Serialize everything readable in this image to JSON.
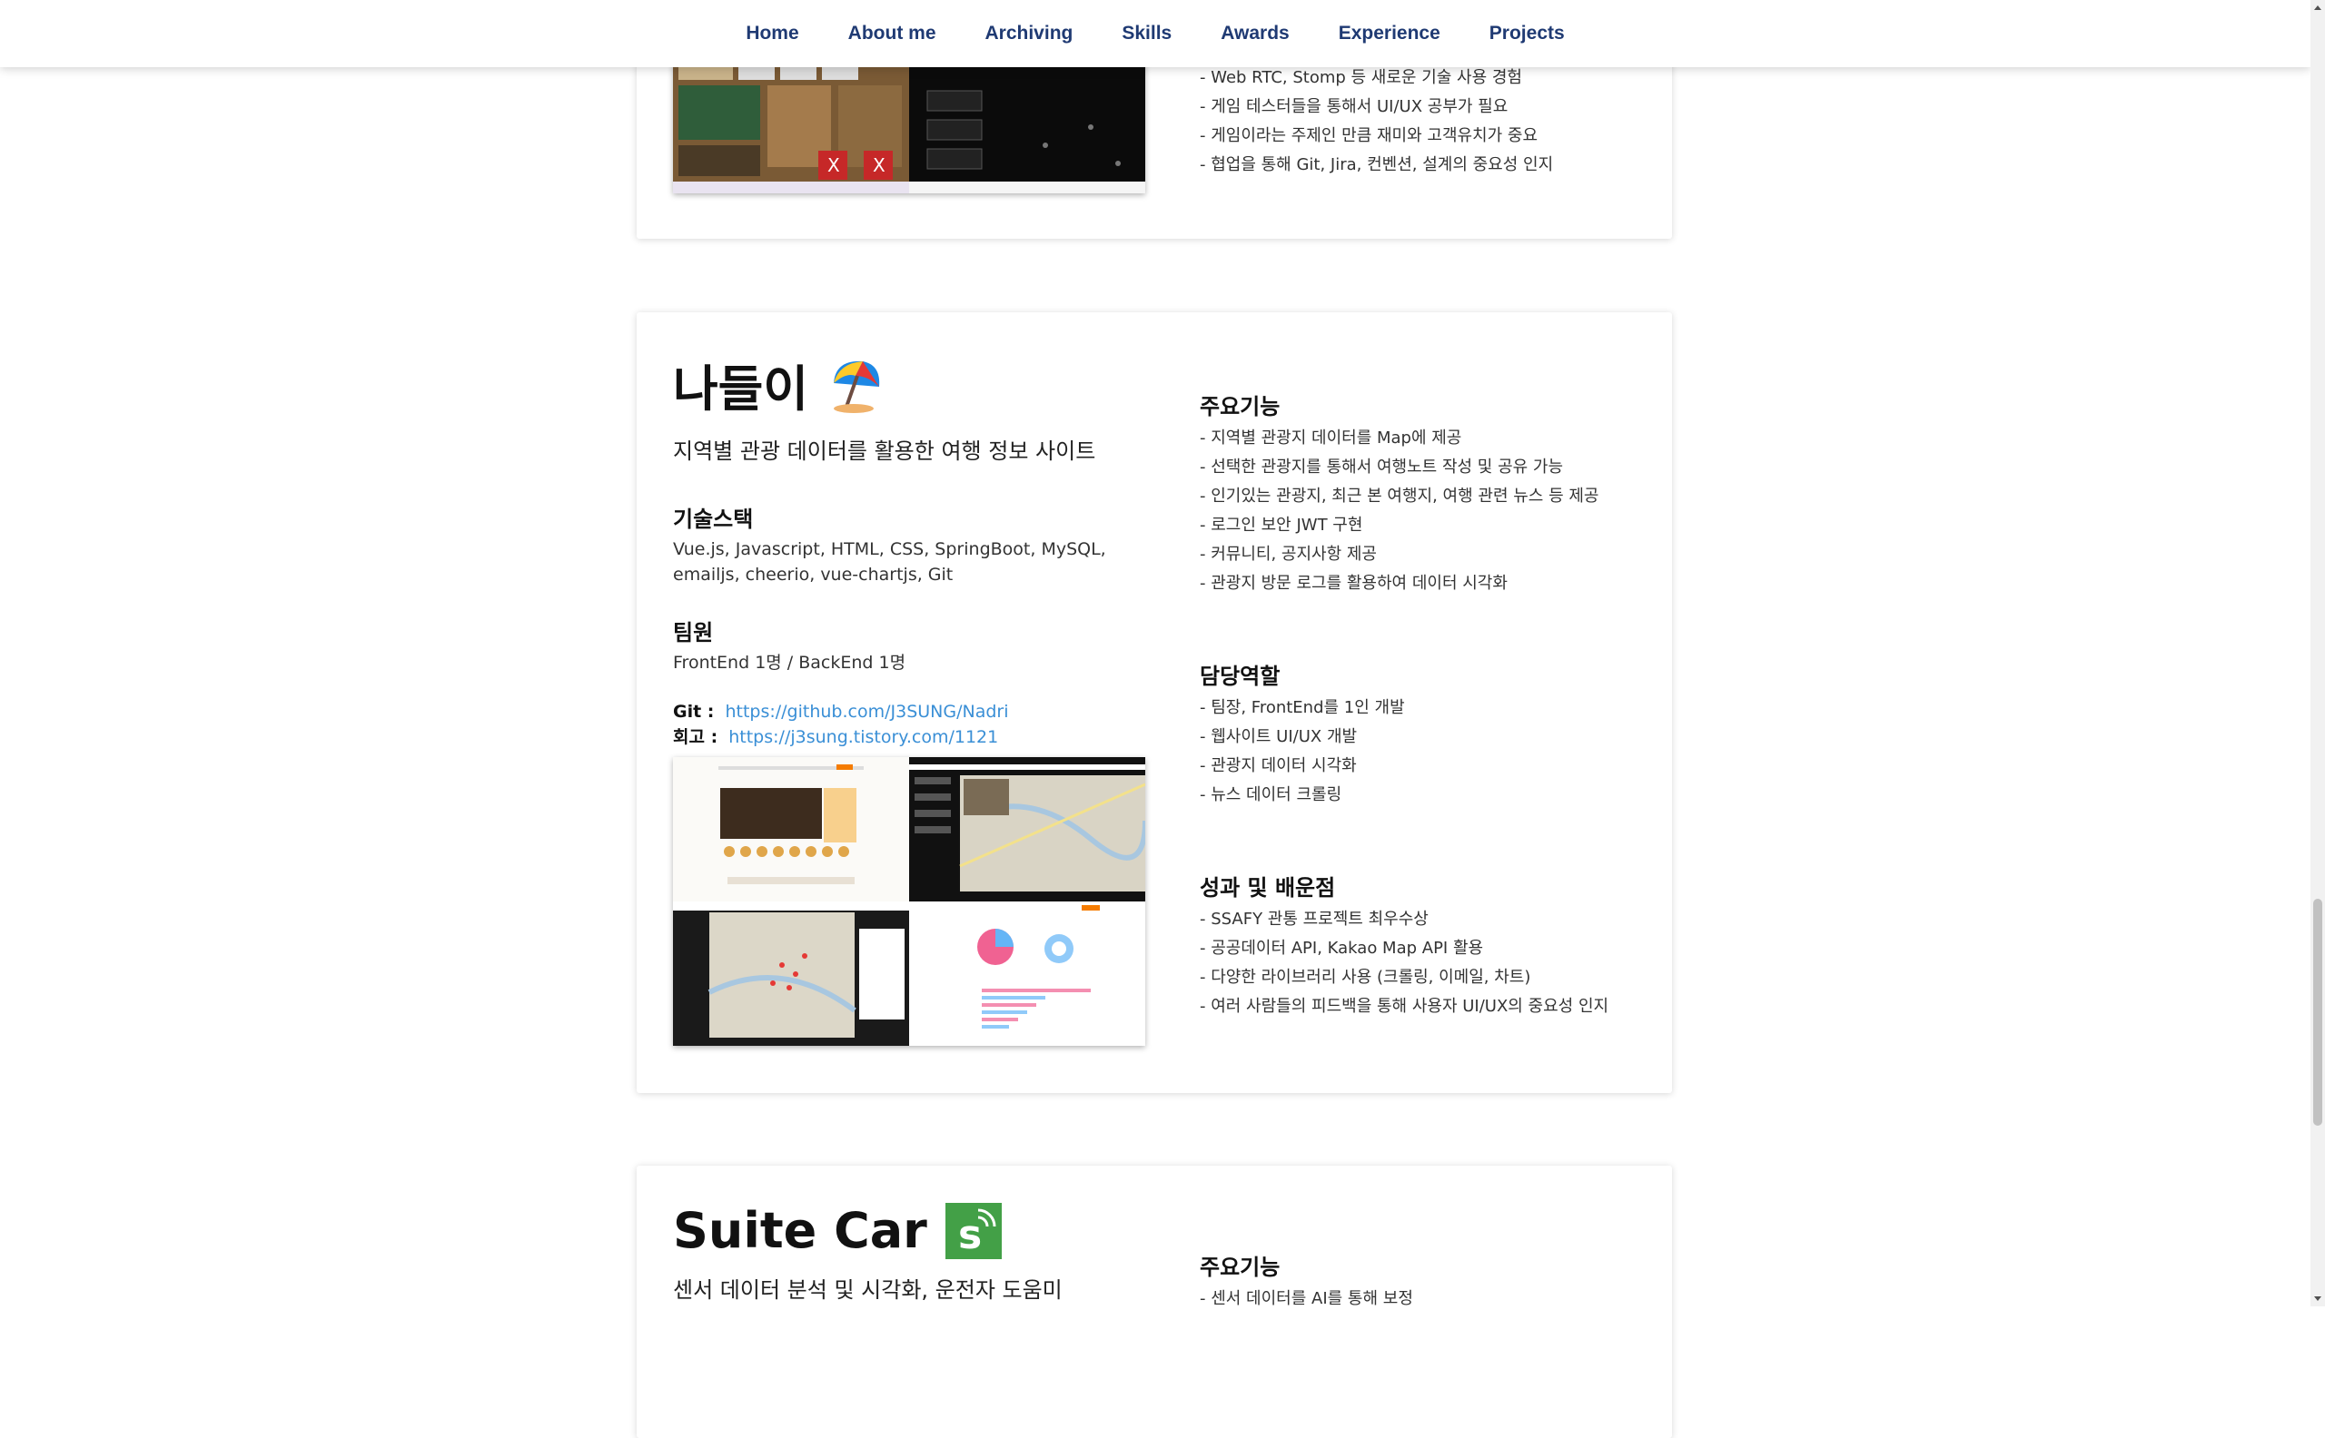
{
  "nav": {
    "items": [
      "Home",
      "About me",
      "Archiving",
      "Skills",
      "Awards",
      "Experience",
      "Projects"
    ]
  },
  "prev_project": {
    "lines": [
      "- Web RTC, Stomp 등 새로운 기술 사용 경험",
      "- 게임 테스터들을 통해서 UI/UX 공부가 필요",
      "- 게임이라는 주제인 만큼 재미와 고객유치가 중요",
      "- 협업을 통해 Git, Jira, 컨벤션, 설계의 중요성 인지"
    ]
  },
  "nadri": {
    "title": "나들이",
    "icon": "beach-umbrella-icon",
    "subtitle": "지역별 관광 데이터를 활용한 여행 정보 사이트",
    "stack_heading": "기술스택",
    "stack": "Vue.js, Javascript, HTML, CSS, SpringBoot, MySQL, emailjs, cheerio, vue-chartjs, Git",
    "team_heading": "팀원",
    "team": "FrontEnd 1명 / BackEnd 1명",
    "git_label": "Git :",
    "git_url": "https://github.com/J3SUNG/Nadri",
    "review_label": "회고 :",
    "review_url": "https://j3sung.tistory.com/1121",
    "features_heading": "주요기능",
    "features": [
      "- 지역별 관광지 데이터를 Map에 제공",
      "- 선택한 관광지를 통해서 여행노트 작성 및 공유 가능",
      "- 인기있는 관광지, 최근 본 여행지, 여행 관련 뉴스 등 제공",
      "- 로그인 보안 JWT 구현",
      "- 커뮤니티, 공지사항 제공",
      "- 관광지 방문 로그를 활용하여 데이터 시각화"
    ],
    "role_heading": "담당역할",
    "roles": [
      "- 팀장, FrontEnd를 1인 개발",
      "- 웹사이트 UI/UX 개발",
      "- 관광지 데이터 시각화",
      "- 뉴스 데이터 크롤링"
    ],
    "result_heading": "성과 및 배운점",
    "results": [
      "- SSAFY 관통 프로젝트 최우수상",
      "- 공공데이터 API, Kakao Map API 활용",
      "- 다양한 라이브러리 사용 (크롤링, 이메일, 차트)",
      "- 여러 사람들의 피드백을 통해 사용자 UI/UX의 중요성 인지"
    ]
  },
  "suitecar": {
    "title": "Suite Car",
    "icon": "suite-car-logo-icon",
    "subtitle": "센서 데이터 분석 및 시각화, 운전자 도움미",
    "features_heading": "주요기능",
    "features": [
      "- 센서 데이터를 AI를 통해 보정"
    ]
  },
  "colors": {
    "nav_text": "#1f3a73",
    "link": "#3a8fd6",
    "suite_green": "#43a047"
  }
}
